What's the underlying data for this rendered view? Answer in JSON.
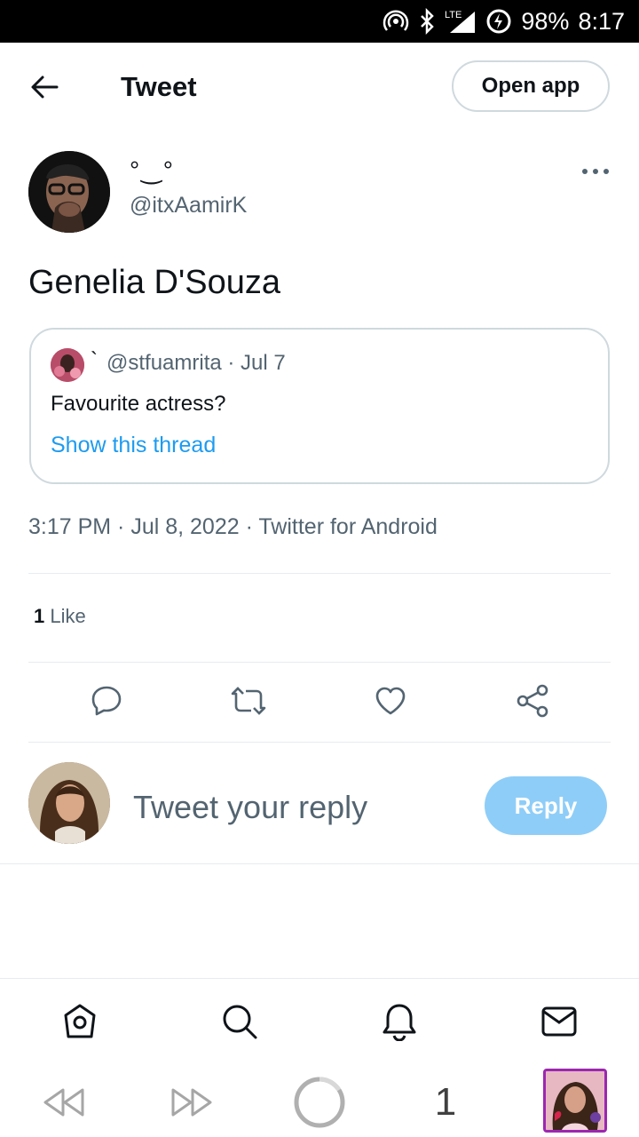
{
  "status_bar": {
    "battery": "98%",
    "time": "8:17",
    "network": "LTE"
  },
  "header": {
    "title": "Tweet",
    "open_app": "Open app"
  },
  "tweet": {
    "author": {
      "display_name": "°‿°",
      "handle": "@itxAamirK"
    },
    "text": "Genelia D'Souza",
    "quoted": {
      "display_name": "`",
      "handle_date": "@stfuamrita · Jul 7",
      "text": "Favourite actress?",
      "show_thread": "Show this thread"
    },
    "meta": "3:17 PM · Jul 8, 2022 · Twitter for Android",
    "likes_count": "1",
    "likes_label": "Like"
  },
  "reply": {
    "placeholder": "Tweet your reply",
    "button": "Reply"
  },
  "actions": [
    "reply-icon",
    "retweet-icon",
    "like-icon",
    "share-icon"
  ],
  "bottom_nav": [
    "home-icon",
    "search-icon",
    "notifications-icon",
    "messages-icon"
  ],
  "browser_bar": {
    "tab_count": "1"
  },
  "colors": {
    "accent": "#1d9bf0",
    "reply_disabled": "#8ecdf8",
    "tab_border": "#9c27b0"
  }
}
